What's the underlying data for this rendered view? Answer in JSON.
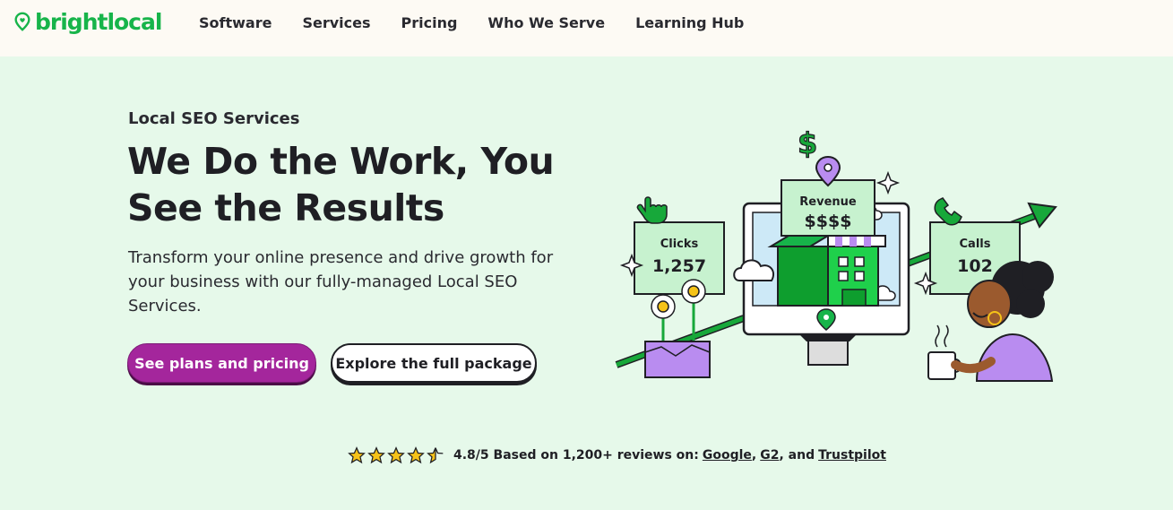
{
  "brand": {
    "logo_text": "brightlocal",
    "brand_color": "#17b44a"
  },
  "nav": {
    "items": [
      "Software",
      "Services",
      "Pricing",
      "Who We Serve",
      "Learning Hub"
    ]
  },
  "hero": {
    "eyebrow": "Local SEO Services",
    "headline": "We Do the Work, You See the Results",
    "subtext": "Transform your online presence and drive growth for your business with our fully-managed Local SEO Services.",
    "primary_cta": "See plans and pricing",
    "secondary_cta": "Explore the full package"
  },
  "illustration": {
    "revenue_label": "Revenue",
    "revenue_value": "$$$$",
    "clicks_label": "Clicks",
    "clicks_value": "1,257",
    "calls_label": "Calls",
    "calls_value": "102",
    "icons": [
      "dollar-icon",
      "location-pin-icon",
      "cursor-hand-icon",
      "phone-icon",
      "sparkle-icon",
      "trend-arrow-icon"
    ]
  },
  "reviews": {
    "rating_value": 4.5,
    "rating_text": "4.8/5 Based on 1,200+ reviews on:",
    "source_google": "Google",
    "source_g2": "G2",
    "sep_and": ", and",
    "source_trustpilot": "Trustpilot"
  },
  "colors": {
    "background": "#e6f9ea",
    "header_bg": "#fdfaf4",
    "primary_button": "#a4269c",
    "accent_green": "#17b44a",
    "purple": "#b98cf0"
  }
}
